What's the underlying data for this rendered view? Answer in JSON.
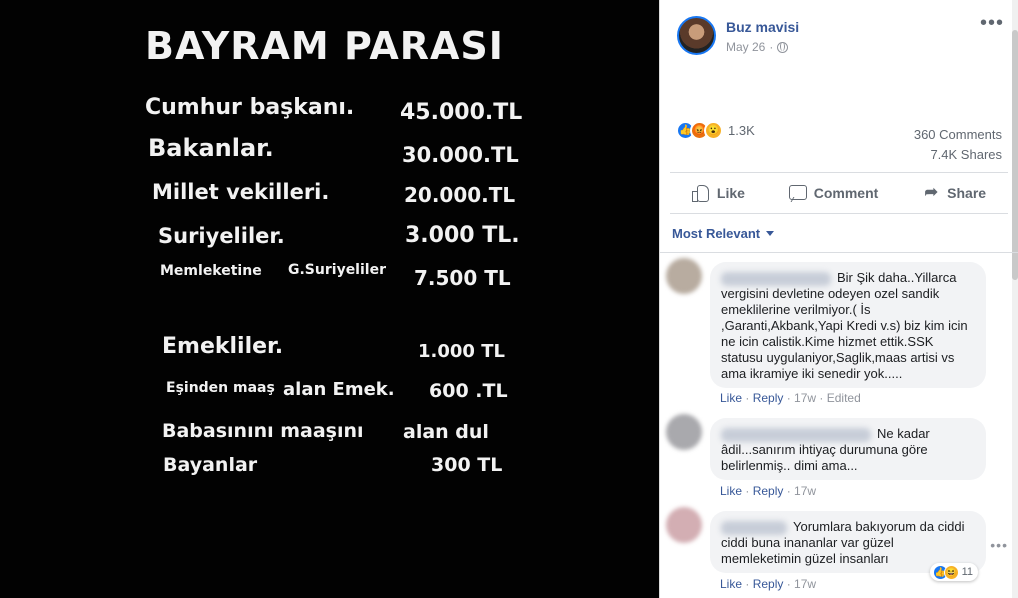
{
  "image": {
    "title": "BAYRAM PARASI",
    "lines": [
      {
        "label": "Cumhur başkanı.",
        "value": "45.000.TL"
      },
      {
        "label": "Bakanlar.",
        "value": "30.000.TL"
      },
      {
        "label": "Millet vekilleri.",
        "value": "20.000.TL"
      },
      {
        "label": "Suriyeliler.",
        "value": "3.000 TL."
      },
      {
        "label_a": "Memleketine",
        "label_b": "G.Suriyeliler",
        "value": "7.500 TL"
      },
      {
        "label": "Emekliler.",
        "value": "1.000 TL"
      },
      {
        "label_a": "Eşinden maaş",
        "label_b": "alan Emek.",
        "value": "600 .TL"
      },
      {
        "label": "Babasınını maaşını",
        "value": "alan dul"
      },
      {
        "label": "Bayanlar",
        "value": "300 TL"
      }
    ]
  },
  "post": {
    "author": "Buz mavisi",
    "date": "May 26",
    "more": "•••",
    "reaction_count": "1.3K",
    "comments_count": "360 Comments",
    "shares_count": "7.4K Shares"
  },
  "actions": {
    "like": "Like",
    "comment": "Comment",
    "share": "Share"
  },
  "sort_label": "Most Relevant",
  "comments": [
    {
      "text": "Bir Şik daha..Yillarca vergisini devletine odeyen ozel sandik emeklilerine verilmiyor.( İs ,Garanti,Akbank,Yapi Kredi v.s) biz kim icin ne icin calistik.Kime hizmet ettik.SSK statusu uygulaniyor,Saglik,maas artisi vs ama ikramiye iki senedir yok.....",
      "like": "Like",
      "reply": "Reply",
      "time": "17w",
      "edited": "Edited"
    },
    {
      "text": "Ne kadar âdil...sanırım ihtiyaç durumuna göre belirlenmiş.. dimi ama...",
      "like": "Like",
      "reply": "Reply",
      "time": "17w"
    },
    {
      "text": "Yorumlara bakıyorum da ciddi ciddi buna inananlar var güzel memleketimin güzel insanları",
      "like": "Like",
      "reply": "Reply",
      "time": "17w",
      "reaction_count": "11"
    }
  ],
  "colors": {
    "link": "#385898",
    "like_blue": "#1877f2",
    "bubble": "#f2f3f5"
  }
}
